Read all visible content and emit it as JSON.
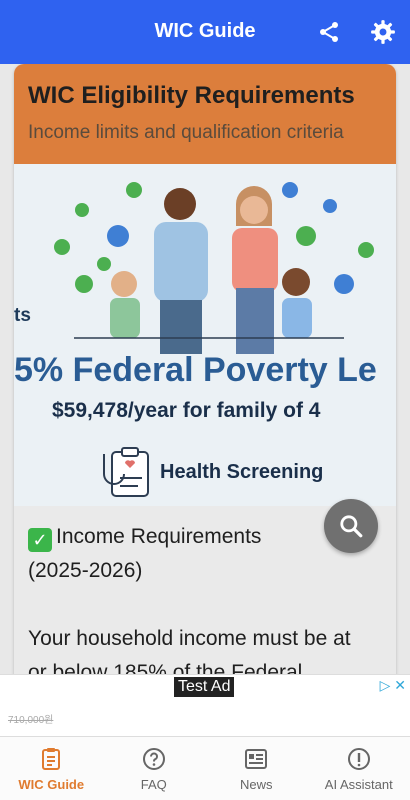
{
  "appbar": {
    "title": "WIC Guide",
    "share_icon": "share-icon",
    "settings_icon": "gear-icon",
    "color": "#2f62f0"
  },
  "card": {
    "title": "WIC Eligibility Requirements",
    "subtitle": "Income limits and qualification criteria",
    "header_color": "#dc7e3c"
  },
  "hero": {
    "left_text": "ts",
    "headline": "5% Federal Poverty Le",
    "income": "$59,478/year for family of 4",
    "screening": "Health Screening"
  },
  "body": {
    "heading": "Income Requirements",
    "years": "(2025-2026)",
    "para": "Your household income must be at or below 185% of the Federal"
  },
  "ad": {
    "label": "Test Ad",
    "price": "710,000원"
  },
  "nav": {
    "items": [
      {
        "label": "WIC Guide",
        "icon": "document-icon",
        "active": true
      },
      {
        "label": "FAQ",
        "icon": "help-icon",
        "active": false
      },
      {
        "label": "News",
        "icon": "news-icon",
        "active": false
      },
      {
        "label": "AI Assistant",
        "icon": "info-icon",
        "active": false
      }
    ],
    "active_color": "#e07b2f"
  }
}
